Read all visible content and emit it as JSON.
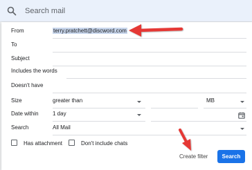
{
  "search": {
    "placeholder": "Search mail"
  },
  "form": {
    "from_label": "From",
    "from_value": "terry.pratchett@discword.com",
    "to_label": "To",
    "subject_label": "Subject",
    "includes_label": "Includes the words",
    "doesnt_have_label": "Doesn't have",
    "size_label": "Size",
    "size_operator": "greater than",
    "size_unit": "MB",
    "date_label": "Date within",
    "date_value": "1 day",
    "search_label": "Search",
    "search_value": "All Mail",
    "has_attachment_label": "Has attachment",
    "no_chats_label": "Don't include chats",
    "create_filter_label": "Create filter",
    "search_button_label": "Search"
  },
  "colors": {
    "accent": "#1a73e8",
    "annotation_arrow": "#e53935"
  },
  "icons": [
    "search-icon",
    "calendar-icon",
    "dropdown-caret-icon",
    "arrow-annotation-icon"
  ]
}
